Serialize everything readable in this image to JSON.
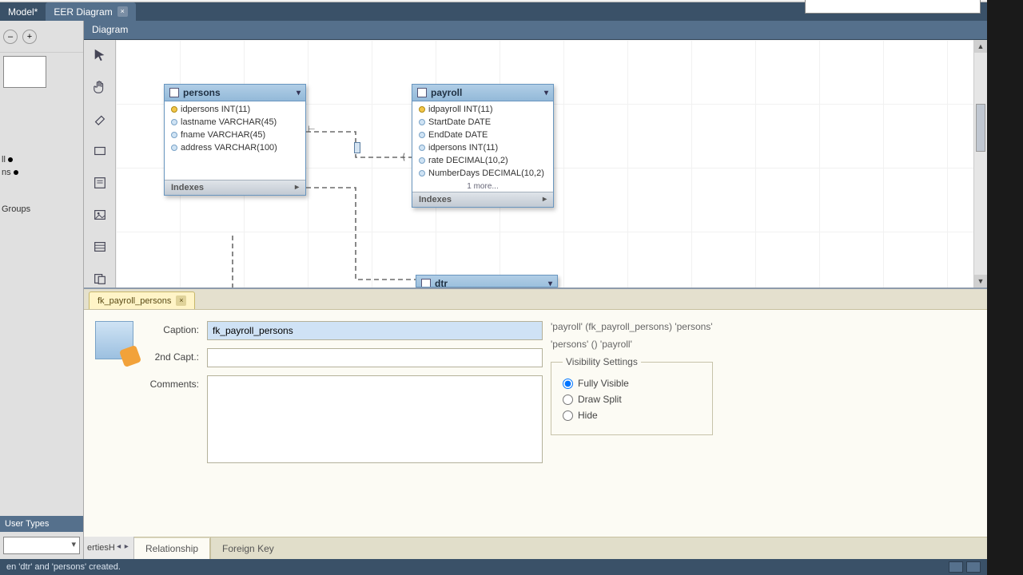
{
  "tabs": {
    "model": "Model*",
    "eer": "EER Diagram"
  },
  "diagram": {
    "title": "Diagram"
  },
  "left": {
    "tree": {
      "group1": "ll",
      "group2": "ns"
    },
    "groups": "Groups",
    "usertypes": "User Types"
  },
  "entities": {
    "persons": {
      "name": "persons",
      "cols": [
        {
          "n": "idpersons INT(11)",
          "pk": true
        },
        {
          "n": "lastname VARCHAR(45)"
        },
        {
          "n": "fname VARCHAR(45)"
        },
        {
          "n": "address VARCHAR(100)"
        }
      ],
      "indexes": "Indexes"
    },
    "payroll": {
      "name": "payroll",
      "cols": [
        {
          "n": "idpayroll INT(11)",
          "pk": true
        },
        {
          "n": "StartDate DATE"
        },
        {
          "n": "EndDate DATE"
        },
        {
          "n": "idpersons INT(11)"
        },
        {
          "n": "rate DECIMAL(10,2)"
        },
        {
          "n": "NumberDays DECIMAL(10,2)"
        }
      ],
      "more": "1 more...",
      "indexes": "Indexes"
    },
    "dtr": {
      "name": "dtr"
    }
  },
  "props": {
    "tab": "fk_payroll_persons",
    "labels": {
      "caption": "Caption:",
      "second": "2nd Capt.:",
      "comments": "Comments:"
    },
    "caption": "fk_payroll_persons",
    "second": "",
    "comments": "",
    "desc1": "'payroll' (fk_payroll_persons) 'persons'",
    "desc2": "'persons' () 'payroll'",
    "vis": {
      "legend": "Visibility Settings",
      "full": "Fully Visible",
      "split": "Draw Split",
      "hide": "Hide"
    },
    "bottom": {
      "relationship": "Relationship",
      "fk": "Foreign Key"
    },
    "leftfloat": {
      "properties": "erties",
      "h": "H"
    }
  },
  "status": {
    "msg": "en 'dtr' and 'persons' created."
  }
}
